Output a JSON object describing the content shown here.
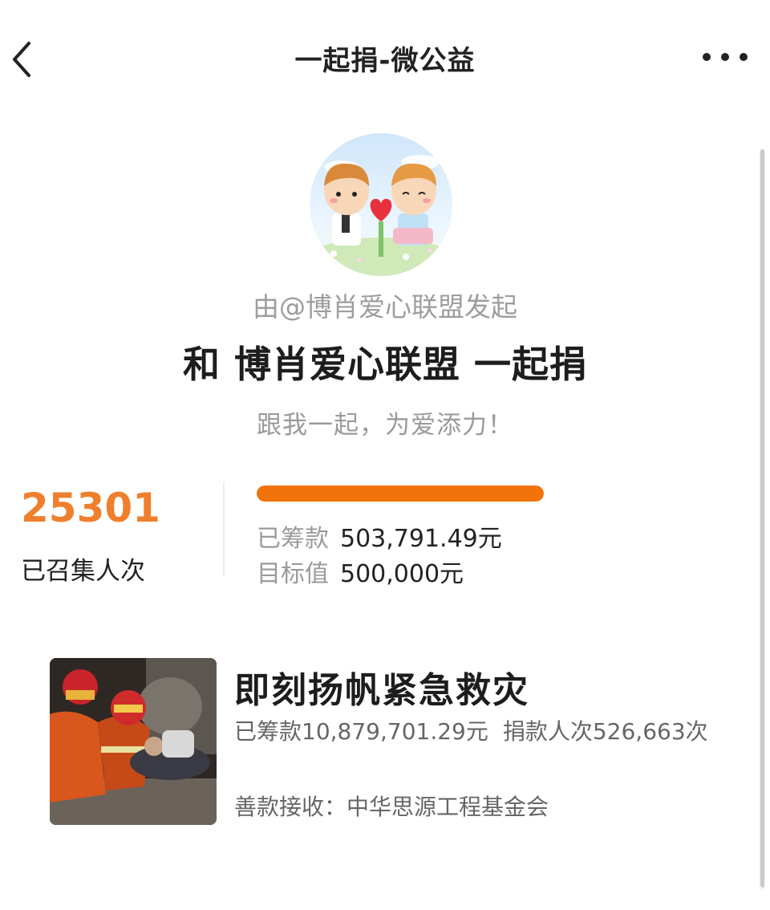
{
  "header": {
    "title": "一起捐-微公益",
    "back_icon": "chevron-left-icon",
    "more_icon": "more-horizontal-icon"
  },
  "initiator": {
    "text": "由@博肖爱心联盟发起",
    "avatar": "couple-heart-avatar"
  },
  "campaign": {
    "headline": "和 博肖爱心联盟 一起捐",
    "slogan": "跟我一起，为爱添力！"
  },
  "stats": {
    "count": "25301",
    "count_label": "已召集人次",
    "progress_fraction": 1.0,
    "raised_label": "已筹款",
    "raised_value": "503,791.49元",
    "target_label": "目标值",
    "target_value": "500,000元",
    "accent_color": "#ef7f2c",
    "progress_color": "#f2730a"
  },
  "project": {
    "title": "即刻扬帆紧急救灾",
    "raised": "已筹款10,879,701.29元",
    "donors": "捐款人次526,663次",
    "receiver": "善款接收：中华思源工程基金会",
    "thumbnail": "rescue-scene-photo"
  }
}
